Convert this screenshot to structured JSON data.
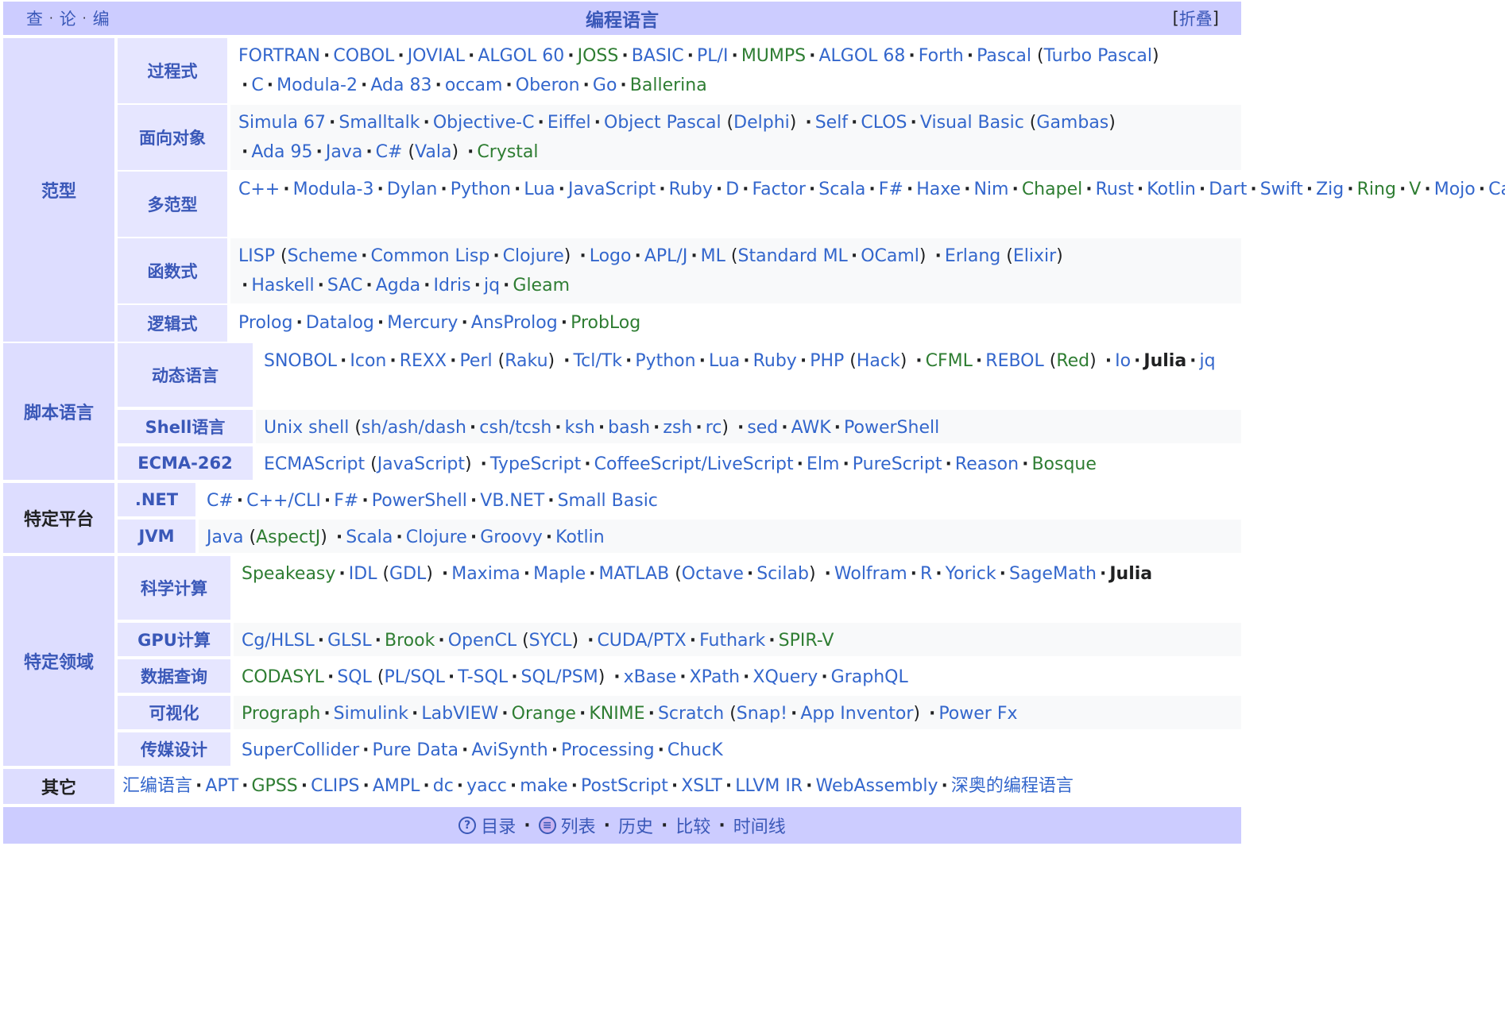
{
  "header": {
    "vde": [
      "查",
      "论",
      "编"
    ],
    "title": "编程语言",
    "collapse_label": "折叠"
  },
  "groups": [
    {
      "name": "范型",
      "rows": [
        {
          "label": "过程式",
          "items": [
            {
              "t": "FORTRAN",
              "c": "blue"
            },
            {
              "t": "COBOL",
              "c": "blue"
            },
            {
              "t": "JOVIAL",
              "c": "blue"
            },
            {
              "t": "ALGOL 60",
              "c": "blue"
            },
            {
              "t": "JOSS",
              "c": "green"
            },
            {
              "t": "BASIC",
              "c": "blue"
            },
            {
              "t": "PL/I",
              "c": "blue"
            },
            {
              "t": "MUMPS",
              "c": "green"
            },
            {
              "t": "ALGOL 68",
              "c": "blue"
            },
            {
              "t": "Forth",
              "c": "blue"
            },
            {
              "t": "Pascal",
              "c": "blue",
              "sub": [
                {
                  "t": "Turbo Pascal",
                  "c": "blue"
                }
              ]
            },
            {
              "t": "C",
              "c": "blue"
            },
            {
              "t": "Modula-2",
              "c": "blue"
            },
            {
              "t": "Ada 83",
              "c": "blue"
            },
            {
              "t": "occam",
              "c": "blue"
            },
            {
              "t": "Oberon",
              "c": "blue"
            },
            {
              "t": "Go",
              "c": "blue"
            },
            {
              "t": "Ballerina",
              "c": "green"
            }
          ]
        },
        {
          "label": "面向对象",
          "items": [
            {
              "t": "Simula 67",
              "c": "blue"
            },
            {
              "t": "Smalltalk",
              "c": "blue"
            },
            {
              "t": "Objective-C",
              "c": "blue"
            },
            {
              "t": "Eiffel",
              "c": "blue"
            },
            {
              "t": "Object Pascal",
              "c": "blue",
              "sub": [
                {
                  "t": "Delphi",
                  "c": "blue"
                }
              ]
            },
            {
              "t": "Self",
              "c": "blue"
            },
            {
              "t": "CLOS",
              "c": "blue"
            },
            {
              "t": "Visual Basic",
              "c": "blue",
              "sub": [
                {
                  "t": "Gambas",
                  "c": "blue"
                }
              ]
            },
            {
              "t": "Ada 95",
              "c": "blue"
            },
            {
              "t": "Java",
              "c": "blue"
            },
            {
              "t": "C#",
              "c": "blue",
              "sub": [
                {
                  "t": "Vala",
                  "c": "blue"
                }
              ]
            },
            {
              "t": "Crystal",
              "c": "green"
            }
          ]
        },
        {
          "label": "多范型",
          "items": [
            {
              "t": "C++",
              "c": "blue"
            },
            {
              "t": "Modula-3",
              "c": "blue"
            },
            {
              "t": "Dylan",
              "c": "blue"
            },
            {
              "t": "Python",
              "c": "blue"
            },
            {
              "t": "Lua",
              "c": "blue"
            },
            {
              "t": "JavaScript",
              "c": "blue"
            },
            {
              "t": "Ruby",
              "c": "blue"
            },
            {
              "t": "D",
              "c": "blue"
            },
            {
              "t": "Factor",
              "c": "blue"
            },
            {
              "t": "Scala",
              "c": "blue"
            },
            {
              "t": "F#",
              "c": "blue"
            },
            {
              "t": "Haxe",
              "c": "blue"
            },
            {
              "t": "Nim",
              "c": "blue"
            },
            {
              "t": "Chapel",
              "c": "green"
            },
            {
              "t": "Rust",
              "c": "blue"
            },
            {
              "t": "Kotlin",
              "c": "blue"
            },
            {
              "t": "Dart",
              "c": "blue"
            },
            {
              "t": "Swift",
              "c": "blue"
            },
            {
              "t": "Zig",
              "c": "blue"
            },
            {
              "t": "Ring",
              "c": "green"
            },
            {
              "t": "V",
              "c": "green"
            },
            {
              "t": "Mojo",
              "c": "blue"
            },
            {
              "t": "Carbon",
              "c": "blue"
            }
          ]
        },
        {
          "label": "函数式",
          "items": [
            {
              "t": "LISP",
              "c": "blue",
              "sub": [
                {
                  "t": "Scheme",
                  "c": "blue"
                },
                {
                  "t": "Common Lisp",
                  "c": "blue"
                },
                {
                  "t": "Clojure",
                  "c": "blue"
                }
              ]
            },
            {
              "t": "Logo",
              "c": "blue"
            },
            {
              "t": "APL/J",
              "c": "blue"
            },
            {
              "t": "ML",
              "c": "blue",
              "sub": [
                {
                  "t": "Standard ML",
                  "c": "blue"
                },
                {
                  "t": "OCaml",
                  "c": "blue"
                }
              ]
            },
            {
              "t": "Erlang",
              "c": "blue",
              "sub": [
                {
                  "t": "Elixir",
                  "c": "blue"
                }
              ]
            },
            {
              "t": "Haskell",
              "c": "blue"
            },
            {
              "t": "SAC",
              "c": "blue"
            },
            {
              "t": "Agda",
              "c": "blue"
            },
            {
              "t": "Idris",
              "c": "blue"
            },
            {
              "t": "jq",
              "c": "blue"
            },
            {
              "t": "Gleam",
              "c": "green"
            }
          ]
        },
        {
          "label": "逻辑式",
          "items": [
            {
              "t": "Prolog",
              "c": "blue"
            },
            {
              "t": "Datalog",
              "c": "blue"
            },
            {
              "t": "Mercury",
              "c": "blue"
            },
            {
              "t": "AnsProlog",
              "c": "blue"
            },
            {
              "t": "ProbLog",
              "c": "green"
            }
          ]
        }
      ]
    },
    {
      "name": "脚本语言",
      "rows": [
        {
          "label": "动态语言",
          "items": [
            {
              "t": "SNOBOL",
              "c": "blue"
            },
            {
              "t": "Icon",
              "c": "blue"
            },
            {
              "t": "REXX",
              "c": "blue"
            },
            {
              "t": "Perl",
              "c": "blue",
              "sub": [
                {
                  "t": "Raku",
                  "c": "blue"
                }
              ]
            },
            {
              "t": "Tcl/Tk",
              "c": "blue"
            },
            {
              "t": "Python",
              "c": "blue"
            },
            {
              "t": "Lua",
              "c": "blue"
            },
            {
              "t": "Ruby",
              "c": "blue"
            },
            {
              "t": "PHP",
              "c": "blue",
              "sub": [
                {
                  "t": "Hack",
                  "c": "blue"
                }
              ]
            },
            {
              "t": "CFML",
              "c": "green"
            },
            {
              "t": "REBOL",
              "c": "blue",
              "sub": [
                {
                  "t": "Red",
                  "c": "green"
                }
              ]
            },
            {
              "t": "Io",
              "c": "blue"
            },
            {
              "t": "Julia",
              "c": "bold"
            },
            {
              "t": "jq",
              "c": "blue"
            }
          ]
        },
        {
          "label": "Shell语言",
          "items": [
            {
              "t": "Unix shell",
              "c": "blue",
              "sub": [
                {
                  "t": "sh/ash/dash",
                  "c": "blue"
                },
                {
                  "t": "csh/tcsh",
                  "c": "blue"
                },
                {
                  "t": "ksh",
                  "c": "blue"
                },
                {
                  "t": "bash",
                  "c": "blue"
                },
                {
                  "t": "zsh",
                  "c": "blue"
                },
                {
                  "t": "rc",
                  "c": "blue"
                }
              ]
            },
            {
              "t": "sed",
              "c": "blue"
            },
            {
              "t": "AWK",
              "c": "blue"
            },
            {
              "t": "PowerShell",
              "c": "blue"
            }
          ]
        },
        {
          "label": "ECMA-262",
          "items": [
            {
              "t": "ECMAScript",
              "c": "blue",
              "sub": [
                {
                  "t": "JavaScript",
                  "c": "blue"
                }
              ]
            },
            {
              "t": "TypeScript",
              "c": "blue"
            },
            {
              "t": "CoffeeScript/LiveScript",
              "c": "blue"
            },
            {
              "t": "Elm",
              "c": "blue"
            },
            {
              "t": "PureScript",
              "c": "blue"
            },
            {
              "t": "Reason",
              "c": "blue"
            },
            {
              "t": "Bosque",
              "c": "green"
            }
          ]
        }
      ]
    },
    {
      "name": "特定平台",
      "plain": true,
      "rows": [
        {
          "label": ".NET",
          "items": [
            {
              "t": "C#",
              "c": "blue"
            },
            {
              "t": "C++/CLI",
              "c": "blue"
            },
            {
              "t": "F#",
              "c": "blue"
            },
            {
              "t": "PowerShell",
              "c": "blue"
            },
            {
              "t": "VB.NET",
              "c": "blue"
            },
            {
              "t": "Small Basic",
              "c": "blue"
            }
          ]
        },
        {
          "label": "JVM",
          "items": [
            {
              "t": "Java",
              "c": "blue",
              "sub": [
                {
                  "t": "AspectJ",
                  "c": "green"
                }
              ]
            },
            {
              "t": "Scala",
              "c": "blue"
            },
            {
              "t": "Clojure",
              "c": "blue"
            },
            {
              "t": "Groovy",
              "c": "blue"
            },
            {
              "t": "Kotlin",
              "c": "blue"
            }
          ]
        }
      ]
    },
    {
      "name": "特定领域",
      "rows": [
        {
          "label": "科学计算",
          "items": [
            {
              "t": "Speakeasy",
              "c": "green"
            },
            {
              "t": "IDL",
              "c": "blue",
              "sub": [
                {
                  "t": "GDL",
                  "c": "blue"
                }
              ]
            },
            {
              "t": "Maxima",
              "c": "blue"
            },
            {
              "t": "Maple",
              "c": "blue"
            },
            {
              "t": "MATLAB",
              "c": "blue",
              "sub": [
                {
                  "t": "Octave",
                  "c": "blue"
                },
                {
                  "t": "Scilab",
                  "c": "blue"
                }
              ]
            },
            {
              "t": "Wolfram",
              "c": "blue"
            },
            {
              "t": "R",
              "c": "blue"
            },
            {
              "t": "Yorick",
              "c": "blue"
            },
            {
              "t": "SageMath",
              "c": "blue"
            },
            {
              "t": "Julia",
              "c": "bold"
            }
          ]
        },
        {
          "label": "GPU计算",
          "items": [
            {
              "t": "Cg/HLSL",
              "c": "blue"
            },
            {
              "t": "GLSL",
              "c": "blue"
            },
            {
              "t": "Brook",
              "c": "green"
            },
            {
              "t": "OpenCL",
              "c": "blue",
              "sub": [
                {
                  "t": "SYCL",
                  "c": "blue"
                }
              ]
            },
            {
              "t": "CUDA/PTX",
              "c": "blue"
            },
            {
              "t": "Futhark",
              "c": "blue"
            },
            {
              "t": "SPIR-V",
              "c": "green"
            }
          ]
        },
        {
          "label": "数据查询",
          "items": [
            {
              "t": "CODASYL",
              "c": "green"
            },
            {
              "t": "SQL",
              "c": "blue",
              "sub": [
                {
                  "t": "PL/SQL",
                  "c": "blue"
                },
                {
                  "t": "T-SQL",
                  "c": "blue"
                },
                {
                  "t": "SQL/PSM",
                  "c": "blue"
                }
              ]
            },
            {
              "t": "xBase",
              "c": "blue"
            },
            {
              "t": "XPath",
              "c": "blue"
            },
            {
              "t": "XQuery",
              "c": "blue"
            },
            {
              "t": "GraphQL",
              "c": "blue"
            }
          ]
        },
        {
          "label": "可视化",
          "items": [
            {
              "t": "Prograph",
              "c": "green"
            },
            {
              "t": "Simulink",
              "c": "blue"
            },
            {
              "t": "LabVIEW",
              "c": "blue"
            },
            {
              "t": "Orange",
              "c": "green"
            },
            {
              "t": "KNIME",
              "c": "green"
            },
            {
              "t": "Scratch",
              "c": "blue",
              "sub": [
                {
                  "t": "Snap!",
                  "c": "blue"
                },
                {
                  "t": "App Inventor",
                  "c": "blue"
                }
              ]
            },
            {
              "t": "Power Fx",
              "c": "blue"
            }
          ]
        },
        {
          "label": "传媒设计",
          "items": [
            {
              "t": "SuperCollider",
              "c": "blue"
            },
            {
              "t": "Pure Data",
              "c": "blue"
            },
            {
              "t": "AviSynth",
              "c": "blue"
            },
            {
              "t": "Processing",
              "c": "blue"
            },
            {
              "t": "ChucK",
              "c": "blue"
            }
          ]
        }
      ]
    }
  ],
  "other": {
    "label": "其它",
    "items": [
      {
        "t": "汇编语言",
        "c": "blue"
      },
      {
        "t": "APT",
        "c": "blue"
      },
      {
        "t": "GPSS",
        "c": "green"
      },
      {
        "t": "CLIPS",
        "c": "blue"
      },
      {
        "t": "AMPL",
        "c": "blue"
      },
      {
        "t": "dc",
        "c": "blue"
      },
      {
        "t": "yacc",
        "c": "blue"
      },
      {
        "t": "make",
        "c": "blue"
      },
      {
        "t": "PostScript",
        "c": "blue"
      },
      {
        "t": "XSLT",
        "c": "blue"
      },
      {
        "t": "LLVM IR",
        "c": "blue"
      },
      {
        "t": "WebAssembly",
        "c": "blue"
      },
      {
        "t": "深奥的编程语言",
        "c": "blue"
      }
    ]
  },
  "footer": {
    "items": [
      {
        "icon": "question-icon",
        "text": "目录"
      },
      {
        "icon": "list-icon",
        "text": "列表"
      },
      {
        "text": "历史"
      },
      {
        "text": "比较"
      },
      {
        "text": "时间线"
      }
    ]
  },
  "colors": {
    "header_bg": "#ccccff",
    "group_bg": "#ddddff",
    "link_blue": "#3366cc",
    "link_green": "#2e7d32"
  }
}
